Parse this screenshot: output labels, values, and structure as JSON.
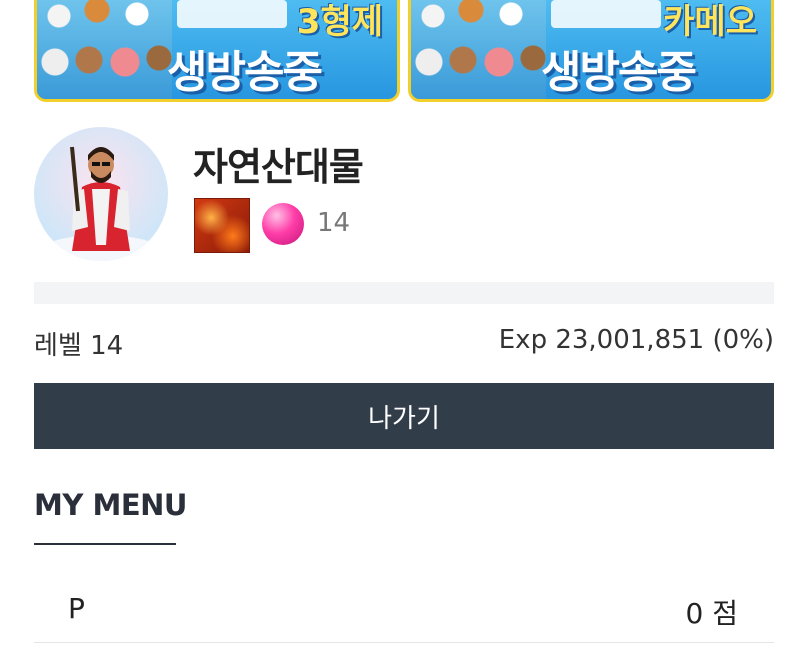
{
  "banners": [
    {
      "top_text": "3형제",
      "main_text": "생방송중"
    },
    {
      "top_text": "카메오",
      "main_text": "생방송중"
    }
  ],
  "profile": {
    "nickname": "자연산대물",
    "level_number": "14"
  },
  "experience": {
    "level_label": "레벨 14",
    "exp_label": "Exp 23,001,851 (0%)",
    "progress_fraction": 0
  },
  "actions": {
    "logout_label": "나가기"
  },
  "menu": {
    "heading": "MY MENU",
    "point_label": "P",
    "point_value": "0 점"
  }
}
